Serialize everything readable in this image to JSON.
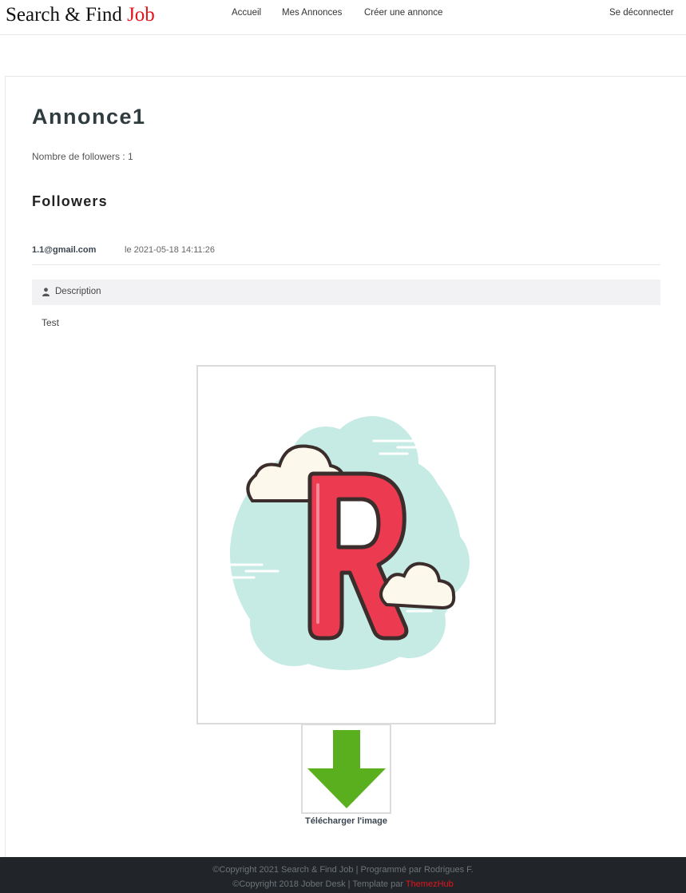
{
  "header": {
    "brand_main": "Search & Find",
    "brand_accent": "Job",
    "nav": [
      "Accueil",
      "Mes Annonces",
      "Créer une annonce"
    ],
    "logout": "Se déconnecter"
  },
  "annonce": {
    "title": "Annonce1",
    "followers_count_text": "Nombre de followers : 1",
    "followers_heading": "Followers",
    "followers": [
      {
        "email": "1.1@gmail.com",
        "date": "le 2021-05-18 14:11:26"
      }
    ],
    "description_label": "Description",
    "description_text": "Test",
    "download_label": "Télécharger l'image"
  },
  "footer": {
    "line1": "©Copyright 2021 Search & Find Job | Programmé par Rodrigues F.",
    "line2_text": "©Copyright 2018 Jober Desk | Template par",
    "line2_link": "ThemezHub"
  },
  "colors": {
    "accent": "#e3141b",
    "footer_bg": "#212529",
    "download_arrow": "#5aaf1e",
    "letter_fill": "#ec3b50",
    "cloud_bg": "#c6ebe5"
  }
}
